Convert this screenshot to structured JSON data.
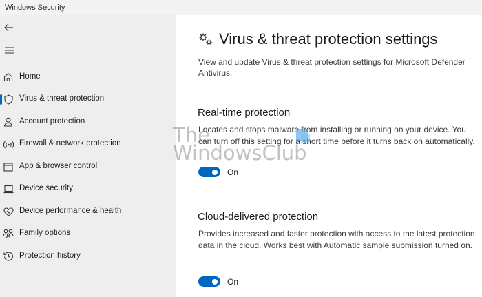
{
  "window": {
    "title": "Windows Security"
  },
  "sidebar": {
    "items": [
      {
        "label": "Home",
        "icon": "home-icon"
      },
      {
        "label": "Virus & threat protection",
        "icon": "shield-icon",
        "selected": true
      },
      {
        "label": "Account protection",
        "icon": "person-icon"
      },
      {
        "label": "Firewall & network protection",
        "icon": "wifi-icon"
      },
      {
        "label": "App & browser control",
        "icon": "app-window-icon"
      },
      {
        "label": "Device security",
        "icon": "laptop-icon"
      },
      {
        "label": "Device performance & health",
        "icon": "heart-icon"
      },
      {
        "label": "Family options",
        "icon": "family-icon"
      },
      {
        "label": "Protection history",
        "icon": "history-icon"
      }
    ]
  },
  "main": {
    "title": "Virus & threat protection settings",
    "description": "View and update Virus & threat protection settings for Microsoft Defender Antivirus.",
    "sections": [
      {
        "title": "Real-time protection",
        "description": "Locates and stops malware from installing or running on your device. You can turn off this setting for a short time before it turns back on automatically.",
        "toggle_state": "On",
        "toggle_on": true
      },
      {
        "title": "Cloud-delivered protection",
        "description": "Provides increased and faster protection with access to the latest protection data in the cloud. Works best with Automatic sample submission turned on.",
        "toggle_state": "On",
        "toggle_on": true
      }
    ]
  },
  "watermark": {
    "line1": "The",
    "line2": "WindowsClub"
  },
  "colors": {
    "accent": "#0067c0",
    "sidebar_bg": "#eeeeee"
  }
}
